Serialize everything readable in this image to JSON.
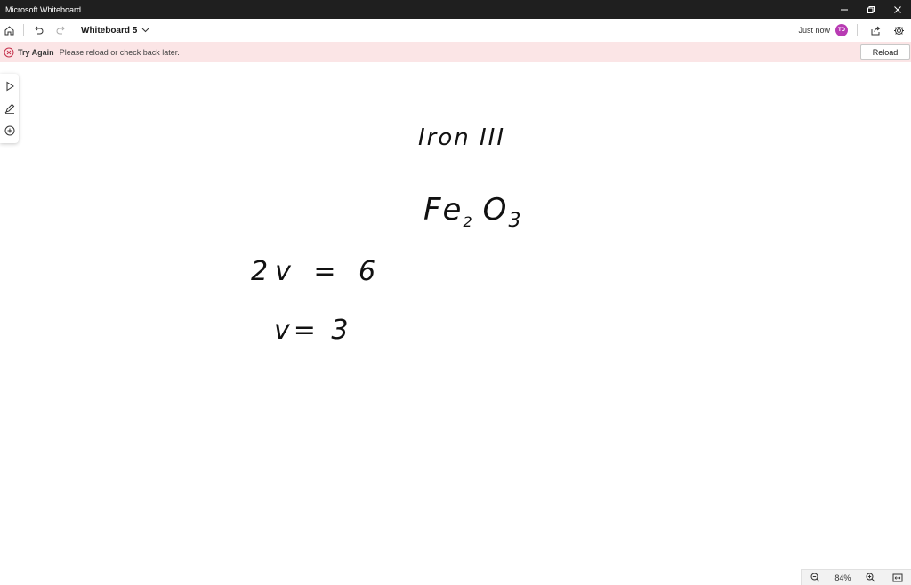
{
  "window": {
    "title": "Microsoft Whiteboard"
  },
  "toolbar": {
    "board_name": "Whiteboard 5",
    "save_status": "Just now",
    "avatar_initials": "TD",
    "avatar_color": "#b83bb3"
  },
  "banner": {
    "title": "Try Again",
    "message": "Please reload or check back later.",
    "reload_label": "Reload",
    "background": "#fbe5e6",
    "icon_color": "#c4314b"
  },
  "canvas": {
    "ink": [
      {
        "text": "Iron III"
      },
      {
        "main": "Fe",
        "sub1": "2",
        "main2": "O",
        "sub2": "3"
      },
      {
        "text": "2v = 6"
      },
      {
        "text": "v= 3"
      }
    ]
  },
  "zoom": {
    "level": "84%"
  },
  "icons": {
    "home": "home-icon",
    "undo": "undo-icon",
    "redo": "redo-icon",
    "share": "share-icon",
    "settings": "gear-icon",
    "select": "select-pointer-icon",
    "pen": "pen-icon",
    "add": "add-circle-icon",
    "zoom_out": "zoom-out-icon",
    "zoom_in": "zoom-in-icon",
    "fit": "fit-to-screen-icon"
  }
}
